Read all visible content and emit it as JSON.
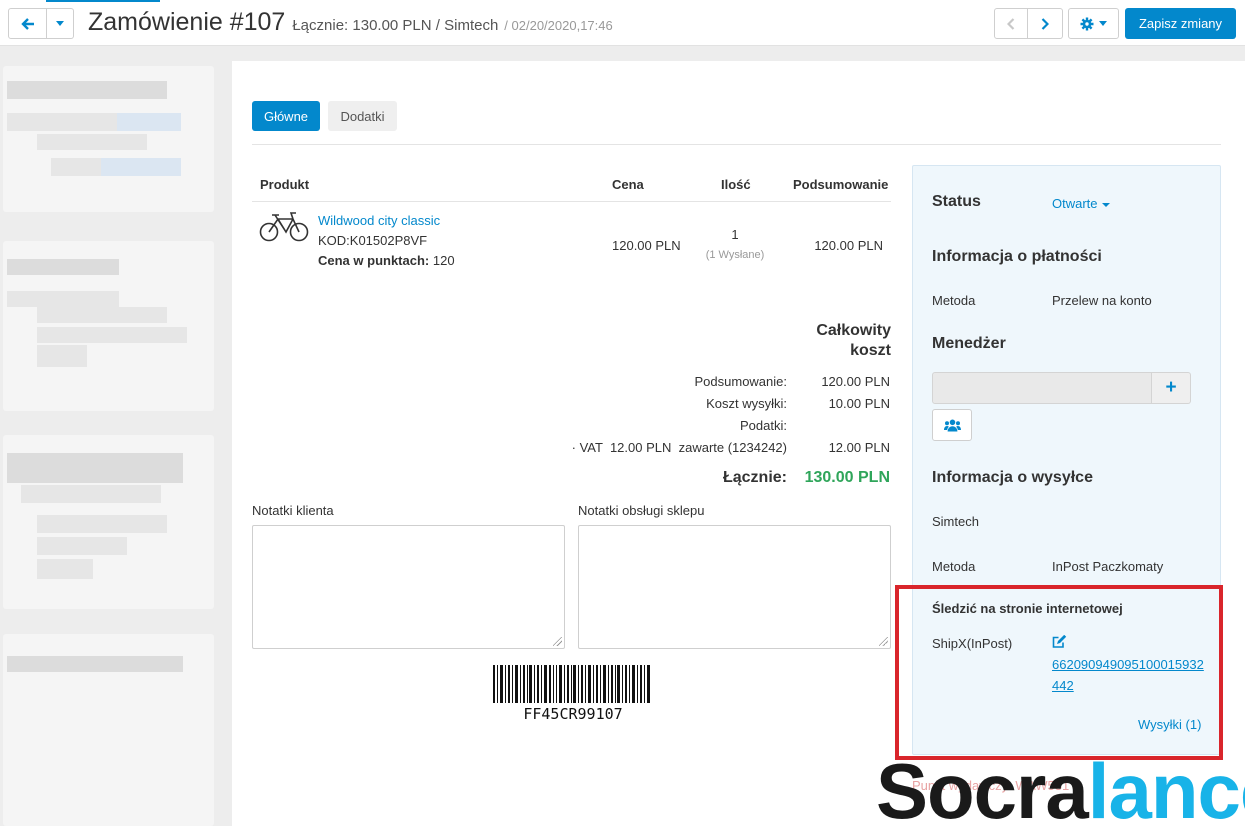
{
  "header": {
    "title": "Zamówienie #107",
    "subtitle": "Łącznie: 130.00 PLN / Simtech",
    "date": "/ 02/20/2020,17:46",
    "save_label": "Zapisz zmiany"
  },
  "tabs": [
    {
      "label": "Główne",
      "active": true
    },
    {
      "label": "Dodatki",
      "active": false
    }
  ],
  "table": {
    "headers": {
      "product": "Produkt",
      "price": "Cena",
      "qty": "Ilość",
      "subtotal": "Podsumowanie"
    },
    "rows": [
      {
        "name": "Wildwood city classic",
        "code": "KOD:K01502P8VF",
        "points_label": "Cena w punktach:",
        "points_value": "120",
        "price": "120.00 PLN",
        "qty": "1",
        "qty_note": "(1 Wysłane)",
        "subtotal": "120.00 PLN",
        "icon": "bicycle-icon"
      }
    ]
  },
  "totals": {
    "heading_line1": "Całkowity",
    "heading_line2": "koszt",
    "rows": [
      {
        "label": "Podsumowanie:",
        "value": "120.00 PLN"
      },
      {
        "label": "Koszt wysyłki:",
        "value": "10.00 PLN"
      },
      {
        "label": "Podatki:",
        "value": ""
      },
      {
        "label": "· VAT  12.00 PLN  zawarte (1234242)",
        "value": "12.00 PLN"
      }
    ],
    "grand_label": "Łącznie:",
    "grand_value": "130.00 PLN"
  },
  "notes": {
    "customer_label": "Notatki klienta",
    "staff_label": "Notatki obsługi sklepu"
  },
  "barcode_text": "FF45CR99107",
  "side": {
    "status_label": "Status",
    "status_value": "Otwarte",
    "payment_heading": "Informacja o płatności",
    "payment_method_label": "Metoda",
    "payment_method_value": "Przelew na konto",
    "manager_heading": "Menedżer",
    "shipping_heading": "Informacja o wysyłce",
    "shipping_company": "Simtech",
    "shipping_method_label": "Metoda",
    "shipping_method_value": "InPost Paczkomaty",
    "tracking_heading": "Śledzić na stronie internetowej",
    "carrier_label": "ShipX(InPost)",
    "tracking_number": "662090949095100015932442",
    "shipments_link": "Wysyłki (1)"
  },
  "overlay": {
    "faded_text": "Punkt wydawczy: WAW531",
    "watermark_dark": "Socra",
    "watermark_blue": "lance"
  },
  "colors": {
    "primary": "#0388cc",
    "total_green": "#2fa55a",
    "highlight_red": "#d9252b",
    "watermark_blue": "#18b3e8"
  }
}
